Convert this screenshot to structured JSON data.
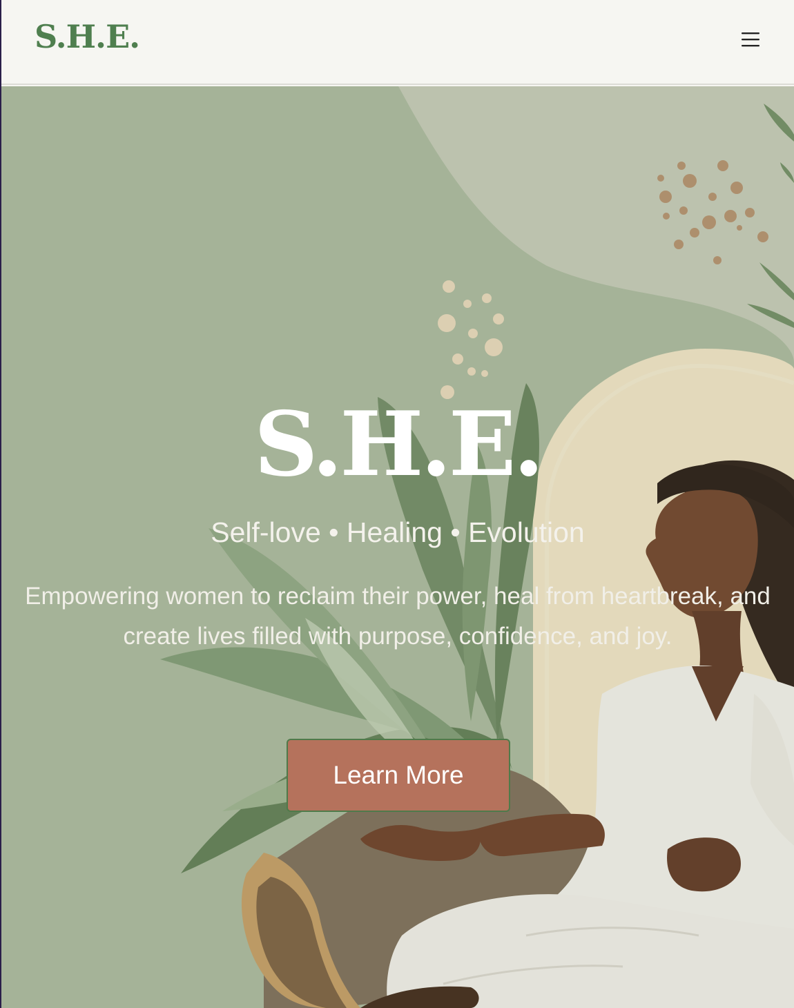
{
  "header": {
    "logo_text": "S.H.E.",
    "menu_icon": "hamburger-menu-icon"
  },
  "hero": {
    "title": "S.H.E.",
    "tagline": "Self-love • Healing • Evolution",
    "description": "Empowering women to reclaim their power, heal from heartbreak, and create lives filled with purpose, confidence, and joy.",
    "cta_label": "Learn More",
    "illustration": "meditating-woman-with-sage-leaves-illustration"
  },
  "colors": {
    "header_bg": "#f6f6f2",
    "logo": "#4f7f4f",
    "hero_bg": "#a8b69a",
    "cta_bg": "#b5725c",
    "cta_border": "#4f7a4a",
    "text_light": "#ffffff"
  }
}
